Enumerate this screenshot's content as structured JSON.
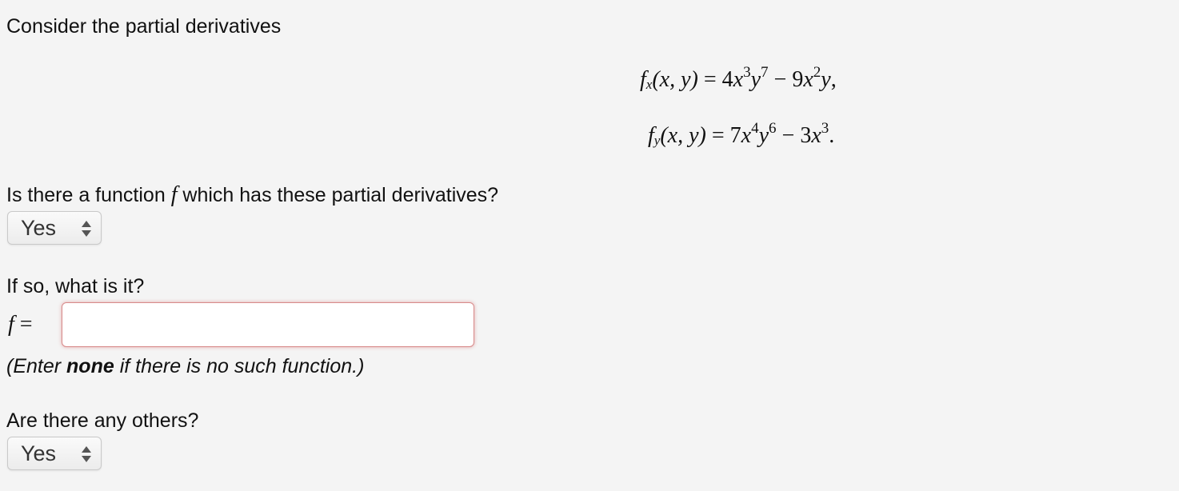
{
  "intro": "Consider the partial derivatives",
  "equations": {
    "fx": {
      "func": "f",
      "sub": "x",
      "args": "(x, y)",
      "eq": "=",
      "t1_coef": "4",
      "t1_v1": "x",
      "t1_e1": "3",
      "t1_v2": "y",
      "t1_e2": "7",
      "op": "−",
      "t2_coef": "9",
      "t2_v1": "x",
      "t2_e1": "2",
      "t2_v2": "y",
      "end": ","
    },
    "fy": {
      "func": "f",
      "sub": "y",
      "args": "(x, y)",
      "eq": "=",
      "t1_coef": "7",
      "t1_v1": "x",
      "t1_e1": "4",
      "t1_v2": "y",
      "t1_e2": "6",
      "op": "−",
      "t2_coef": "3",
      "t2_v1": "x",
      "t2_e1": "3",
      "end": "."
    }
  },
  "q1": {
    "before": "Is there a function ",
    "symbol": "f",
    "after": " which has these partial derivatives?",
    "select_value": "Yes"
  },
  "q2": {
    "label": "If so, what is it?",
    "lhs_symbol": "f",
    "lhs_eq": "=",
    "input_value": "",
    "hint_open": "(Enter ",
    "hint_bold": "none",
    "hint_close": " if there is no such function.)"
  },
  "q3": {
    "label": "Are there any others?",
    "select_value": "Yes"
  }
}
